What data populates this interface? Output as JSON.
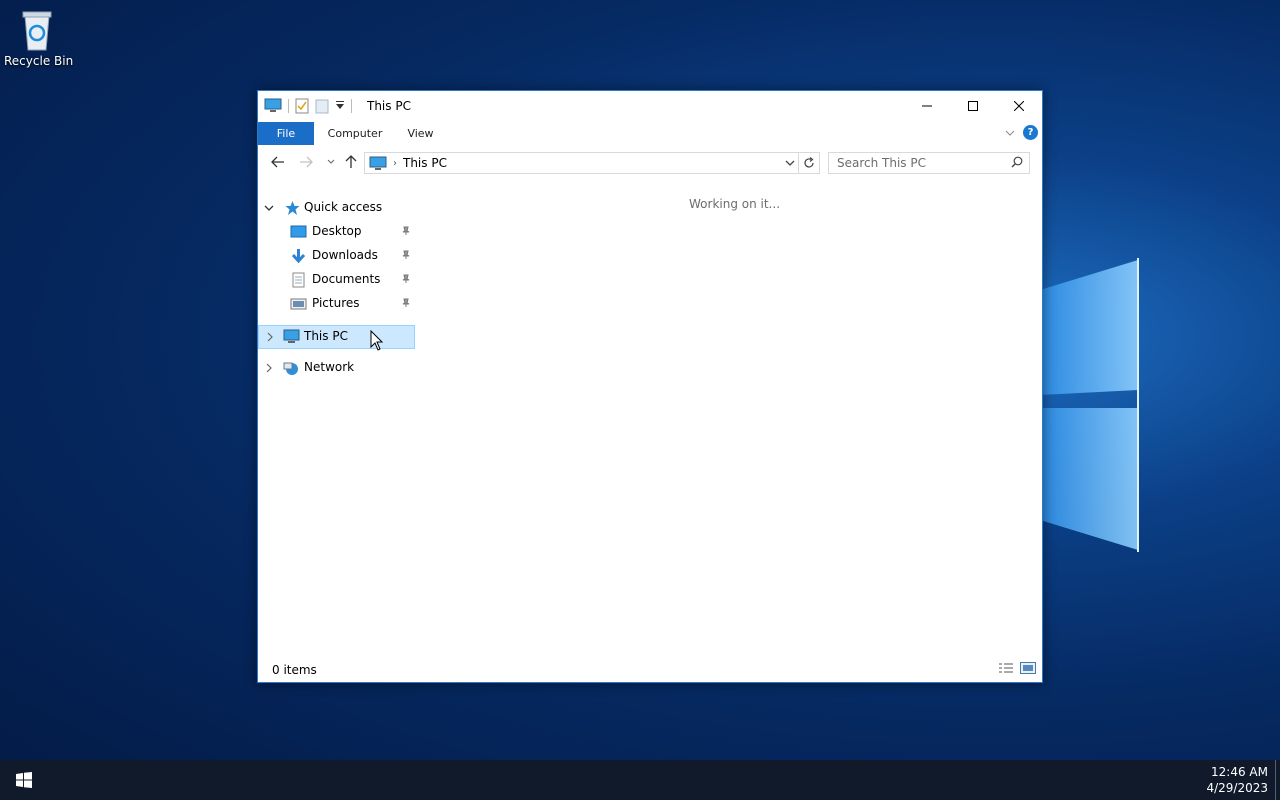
{
  "desktop": {
    "icons": [
      {
        "label": "Recycle Bin",
        "icon": "recycle-bin-icon"
      }
    ]
  },
  "window": {
    "title": "This PC",
    "ribbon_tabs": [
      "File",
      "Computer",
      "View"
    ],
    "help_glyph": "?",
    "address": {
      "crumb": "This PC"
    },
    "search": {
      "placeholder": "Search This PC"
    },
    "nav": {
      "quick_access": "Quick access",
      "quick_items": [
        "Desktop",
        "Downloads",
        "Documents",
        "Pictures"
      ],
      "this_pc": "This PC",
      "network": "Network"
    },
    "content_status": "Working on it...",
    "status_count": "0 items"
  },
  "taskbar": {
    "time": "12:46 AM",
    "date": "4/29/2023"
  },
  "colors": {
    "accent": "#1a6ec7",
    "selection": "#cce8ff",
    "taskbar": "#101a2b"
  }
}
